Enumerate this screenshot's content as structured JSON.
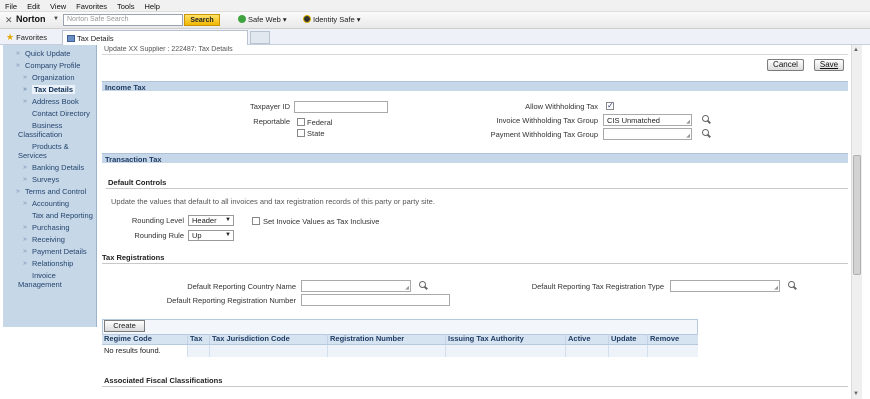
{
  "browser": {
    "menu": [
      "File",
      "Edit",
      "View",
      "Favorites",
      "Tools",
      "Help"
    ],
    "norton": "Norton",
    "search_placeholder": "Norton Safe Search",
    "search_button": "Search",
    "safe_web": "Safe Web",
    "identity_safe": "Identity Safe",
    "favorites": "Favorites",
    "tab_title": "Tax Details"
  },
  "sidebar": {
    "items": [
      "Quick Update",
      "Company Profile",
      "Organization",
      "Tax Details",
      "Address Book",
      "Contact Directory",
      "Business Classification",
      "Products & Services",
      "Banking Details",
      "Surveys",
      "Terms and Control",
      "Accounting",
      "Tax and Reporting",
      "Purchasing",
      "Receiving",
      "Payment Details",
      "Relationship",
      "Invoice Management"
    ]
  },
  "header": {
    "breadcrumb": "Update XX Supplier : 222487: Tax Details",
    "cancel": "Cancel",
    "save": "Save"
  },
  "income_tax": {
    "title": "Income Tax",
    "taxpayer_id_label": "Taxpayer ID",
    "taxpayer_id_value": "",
    "reportable_label": "Reportable",
    "federal_label": "Federal",
    "state_label": "State",
    "allow_withholding_label": "Allow Withholding Tax",
    "invoice_withholding_label": "Invoice Withholding Tax Group",
    "invoice_withholding_value": "CIS Unmatched",
    "payment_withholding_label": "Payment Withholding Tax Group",
    "payment_withholding_value": ""
  },
  "transaction_tax": {
    "title": "Transaction Tax",
    "default_controls": "Default Controls",
    "description": "Update the values that default to all invoices and tax registration records of this party or party site.",
    "rounding_level_label": "Rounding Level",
    "rounding_level_value": "Header",
    "set_inclusive_label": "Set Invoice Values as Tax Inclusive",
    "rounding_rule_label": "Rounding Rule",
    "rounding_rule_value": "Up"
  },
  "tax_registrations": {
    "title": "Tax Registrations",
    "country_label": "Default Reporting Country Name",
    "registration_type_label": "Default Reporting Tax Registration Type",
    "registration_number_label": "Default Reporting Registration Number",
    "create": "Create",
    "columns": [
      "Regime Code",
      "Tax",
      "Tax Jurisdiction Code",
      "Registration Number",
      "Issuing Tax Authority",
      "Active",
      "Update",
      "Remove"
    ],
    "empty": "No results found."
  },
  "fiscal": {
    "title": "Associated Fiscal Classifications"
  }
}
